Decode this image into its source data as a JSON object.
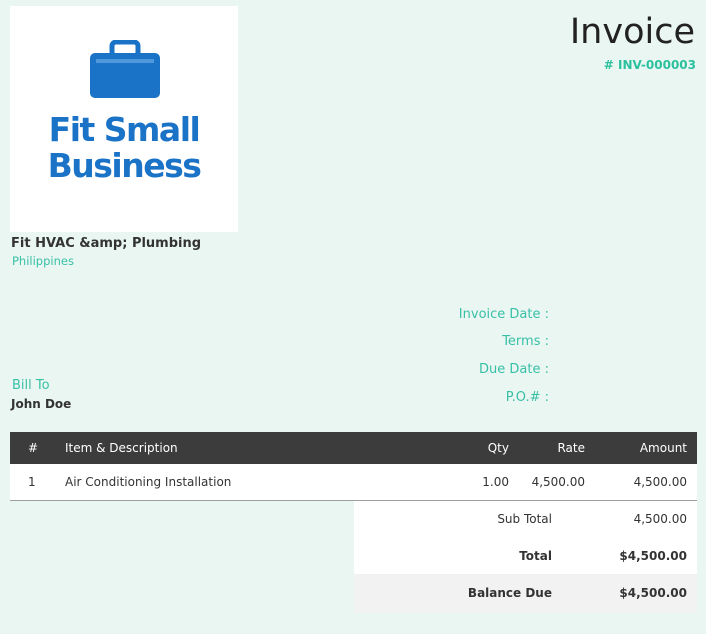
{
  "logo": {
    "line1": "Fit Small",
    "line2": "Business",
    "brand_color": "#1a73c7"
  },
  "company": {
    "name": "Fit HVAC &amp; Plumbing",
    "country": "Philippines"
  },
  "invoice": {
    "title": "Invoice",
    "number": "# INV-000003"
  },
  "meta": {
    "invoice_date_label": "Invoice Date :",
    "terms_label": "Terms :",
    "due_date_label": "Due Date :",
    "po_label": "P.O.# :"
  },
  "bill_to": {
    "label": "Bill To",
    "name": "John Doe"
  },
  "items": {
    "headers": {
      "num": "#",
      "desc": "Item & Description",
      "qty": "Qty",
      "rate": "Rate",
      "amount": "Amount"
    },
    "rows": [
      {
        "num": "1",
        "desc": "Air Conditioning Installation",
        "qty": "1.00",
        "rate": "4,500.00",
        "amount": "4,500.00"
      }
    ]
  },
  "totals": {
    "sub_total_label": "Sub Total",
    "sub_total": "4,500.00",
    "total_label": "Total",
    "total": "$4,500.00",
    "balance_label": "Balance Due",
    "balance": "$4,500.00"
  },
  "colors": {
    "accent": "#38c0a6",
    "header_bg": "#3c3c3c",
    "page_bg": "#eaf6f2"
  }
}
